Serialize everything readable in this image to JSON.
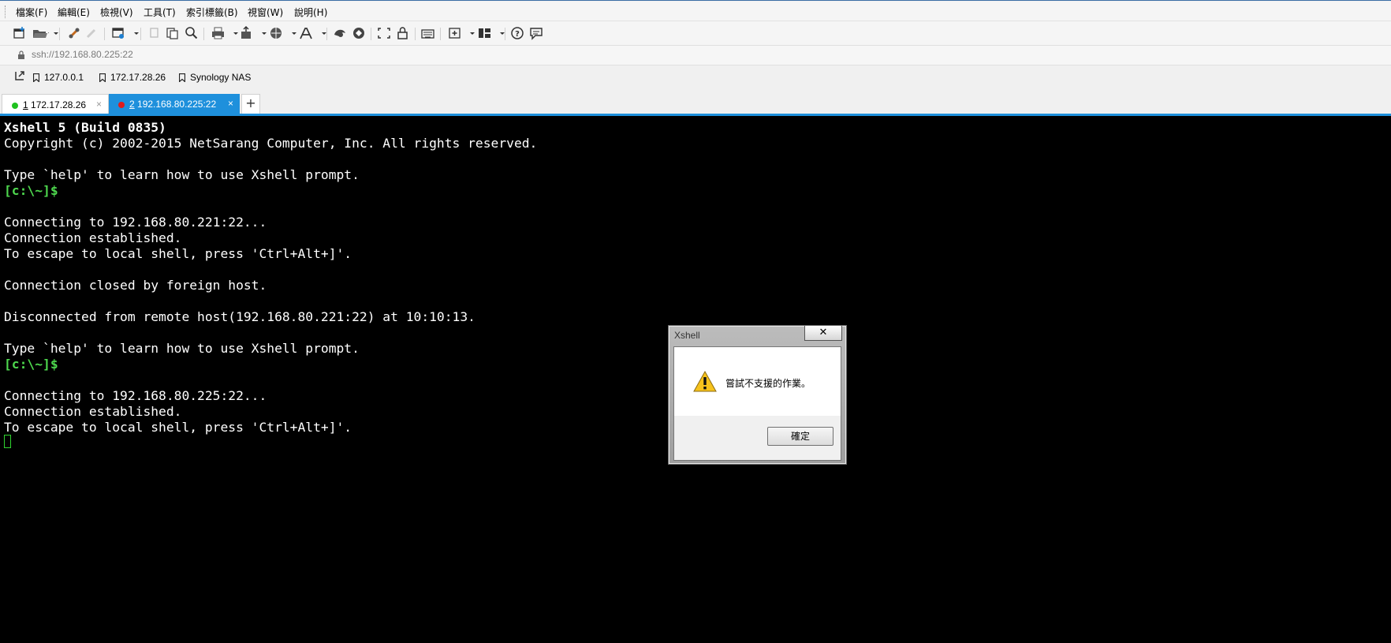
{
  "menu": {
    "items": [
      "檔案(F)",
      "編輯(E)",
      "檢視(V)",
      "工具(T)",
      "索引標籤(B)",
      "視窗(W)",
      "說明(H)"
    ]
  },
  "toolbar": {
    "icons": [
      "new-session-icon",
      "open-folder-icon",
      "reconnect-icon",
      "disconnect-icon",
      "properties-icon",
      "copy-icon",
      "paste-icon",
      "find-icon",
      "print-icon",
      "transfer-icon",
      "globe-icon",
      "font-icon",
      "xftp-icon",
      "xmanager-icon",
      "fullscreen-icon",
      "lock-icon",
      "keyboard-icon",
      "new-tab-icon",
      "layout-icon",
      "help-icon",
      "chat-icon"
    ]
  },
  "address": {
    "value": "ssh://192.168.80.225:22"
  },
  "links": {
    "items": [
      "127.0.0.1",
      "172.17.28.26",
      "Synology NAS"
    ]
  },
  "tabs": [
    {
      "num": "1",
      "label": "172.17.28.26",
      "status_color": "#1fc21f",
      "close": "×"
    },
    {
      "num": "2",
      "label": "192.168.80.225:22",
      "status_color": "#e01c1c",
      "close": "×"
    }
  ],
  "tab_add": "+",
  "terminal": {
    "lines": [
      "Xshell 5 (Build 0835)",
      "Copyright (c) 2002-2015 NetSarang Computer, Inc. All rights reserved.",
      "",
      "Type `help' to learn how to use Xshell prompt.",
      "[c:\\~]$",
      "",
      "Connecting to 192.168.80.221:22...",
      "Connection established.",
      "To escape to local shell, press 'Ctrl+Alt+]'.",
      "",
      "Connection closed by foreign host.",
      "",
      "Disconnected from remote host(192.168.80.221:22) at 10:10:13.",
      "",
      "Type `help' to learn how to use Xshell prompt.",
      "[c:\\~]$",
      "",
      "Connecting to 192.168.80.225:22...",
      "Connection established.",
      "To escape to local shell, press 'Ctrl+Alt+]'."
    ]
  },
  "dialog": {
    "title": "Xshell",
    "close": "✕",
    "message": "嘗試不支援的作業。",
    "ok_label": "確定"
  },
  "colors": {
    "accent": "#1e90dc",
    "prompt": "#4ed84e"
  }
}
